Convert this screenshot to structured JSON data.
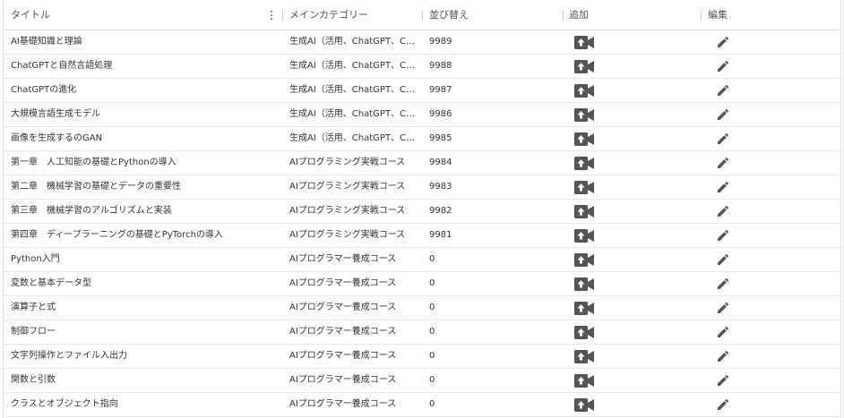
{
  "header": {
    "title": "タイトル",
    "category": "メインカテゴリー",
    "sort": "並び替え",
    "add": "追加",
    "edit": "編集"
  },
  "icons": {
    "add": "video-camera-upload-icon",
    "edit": "pencil-icon",
    "menu": "kebab-menu-icon"
  },
  "colors": {
    "icon": "#555555"
  },
  "rows": [
    {
      "title": "AI基礎知識と理論",
      "category": "生成AI（活用、ChatGPT、C…",
      "sort": "9989"
    },
    {
      "title": "ChatGPTと自然言語処理",
      "category": "生成AI（活用、ChatGPT、C…",
      "sort": "9988"
    },
    {
      "title": "ChatGPTの進化",
      "category": "生成AI（活用、ChatGPT、C…",
      "sort": "9987"
    },
    {
      "title": "大規模言語生成モデル",
      "category": "生成AI（活用、ChatGPT、C…",
      "sort": "9986"
    },
    {
      "title": "画像を生成するのGAN",
      "category": "生成AI（活用、ChatGPT、C…",
      "sort": "9985"
    },
    {
      "title": "第一章　人工知能の基礎とPythonの導入",
      "category": "AIプログラミング実戦コース",
      "sort": "9984"
    },
    {
      "title": "第二章　機械学習の基礎とデータの重要性",
      "category": "AIプログラミング実戦コース",
      "sort": "9983"
    },
    {
      "title": "第三章　機械学習のアルゴリズムと実装",
      "category": "AIプログラミング実戦コース",
      "sort": "9982"
    },
    {
      "title": "第四章　ディープラーニングの基礎とPyTorchの導入",
      "category": "AIプログラミング実戦コース",
      "sort": "9981"
    },
    {
      "title": "Python入門",
      "category": "AIプログラマー養成コース",
      "sort": "0"
    },
    {
      "title": "変数と基本データ型",
      "category": "AIプログラマー養成コース",
      "sort": "0"
    },
    {
      "title": "演算子と式",
      "category": "AIプログラマー養成コース",
      "sort": "0"
    },
    {
      "title": "制御フロー",
      "category": "AIプログラマー養成コース",
      "sort": "0"
    },
    {
      "title": "文字列操作とファイル入出力",
      "category": "AIプログラマー養成コース",
      "sort": "0"
    },
    {
      "title": "関数と引数",
      "category": "AIプログラマー養成コース",
      "sort": "0"
    },
    {
      "title": "クラスとオブジェクト指向",
      "category": "AIプログラマー養成コース",
      "sort": "0"
    }
  ]
}
